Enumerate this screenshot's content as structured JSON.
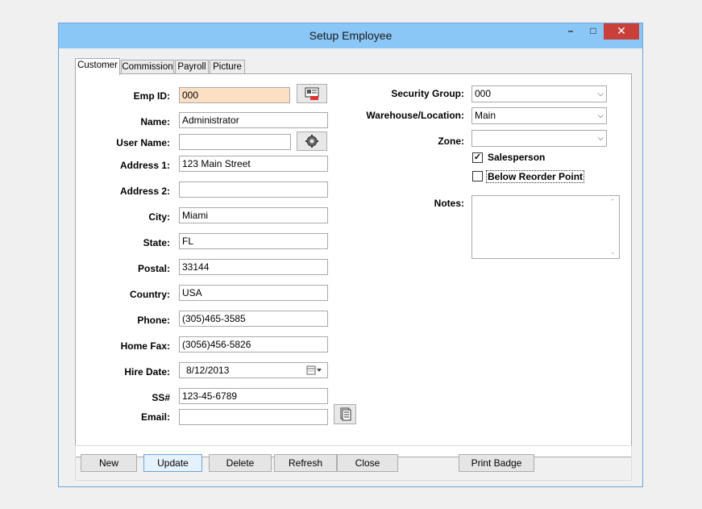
{
  "window": {
    "title": "Setup Employee",
    "minimize": "–",
    "maximize": "□",
    "close": "✕"
  },
  "tabs": [
    {
      "label": "Customer"
    },
    {
      "label": "Commission"
    },
    {
      "label": "Payroll"
    },
    {
      "label": "Picture"
    }
  ],
  "form": {
    "emp_id": {
      "label": "Emp ID:",
      "value": "000"
    },
    "name": {
      "label": "Name:",
      "value": "Administrator"
    },
    "user_name": {
      "label": "User Name:",
      "value": ""
    },
    "address1": {
      "label": "Address 1:",
      "value": "123 Main Street"
    },
    "address2": {
      "label": "Address 2:",
      "value": ""
    },
    "city": {
      "label": "City:",
      "value": "Miami"
    },
    "state": {
      "label": "State:",
      "value": "FL"
    },
    "postal": {
      "label": "Postal:",
      "value": "33144"
    },
    "country": {
      "label": "Country:",
      "value": "USA"
    },
    "phone": {
      "label": "Phone:",
      "value": "(305)465-3585"
    },
    "home_fax": {
      "label": "Home Fax:",
      "value": "(3056)456-5826"
    },
    "hire_date": {
      "label": "Hire Date:",
      "value": "8/12/2013"
    },
    "ssn": {
      "label": "SS#",
      "value": "123-45-6789"
    },
    "email": {
      "label": "Email:",
      "value": ""
    },
    "security_group": {
      "label": "Security Group:",
      "value": "000"
    },
    "warehouse": {
      "label": "Warehouse/Location:",
      "value": "Main"
    },
    "zone": {
      "label": "Zone:",
      "value": ""
    },
    "salesperson": {
      "label": "Salesperson",
      "checked": true
    },
    "below_reorder": {
      "label": "Below Reorder Point",
      "checked": false
    },
    "notes": {
      "label": "Notes:",
      "value": ""
    }
  },
  "buttons": {
    "new": "New",
    "update": "Update",
    "delete": "Delete",
    "refresh": "Refresh",
    "close": "Close",
    "print_badge": "Print Badge"
  },
  "glyphs": {
    "check": "✓",
    "dropdown": "⌵"
  },
  "icons": [
    "id-card-icon",
    "gear-icon",
    "calendar-icon",
    "clipboard-icon",
    "scroll-up-icon",
    "scroll-down-icon"
  ]
}
